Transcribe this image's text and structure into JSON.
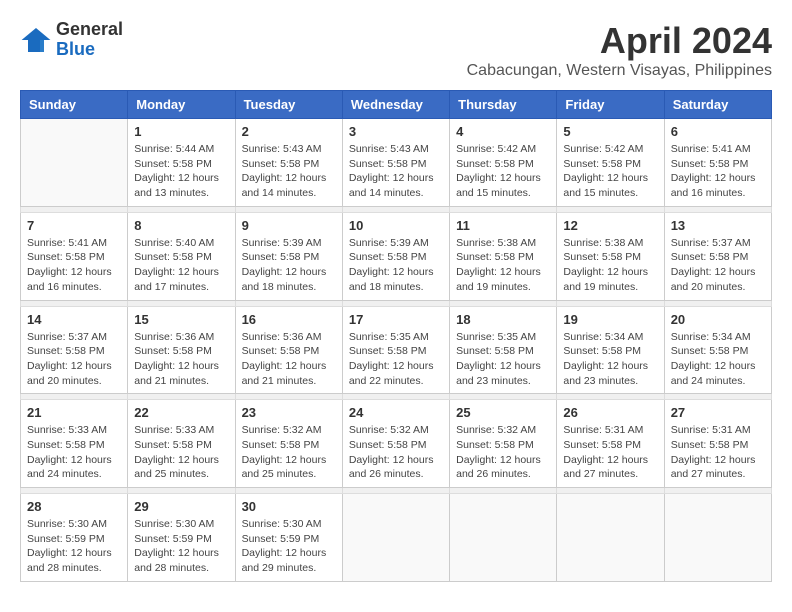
{
  "logo": {
    "general": "General",
    "blue": "Blue"
  },
  "title": "April 2024",
  "location": "Cabacungan, Western Visayas, Philippines",
  "days_of_week": [
    "Sunday",
    "Monday",
    "Tuesday",
    "Wednesday",
    "Thursday",
    "Friday",
    "Saturday"
  ],
  "weeks": [
    [
      {
        "day": "",
        "sunrise": "",
        "sunset": "",
        "daylight": ""
      },
      {
        "day": "1",
        "sunrise": "Sunrise: 5:44 AM",
        "sunset": "Sunset: 5:58 PM",
        "daylight": "Daylight: 12 hours and 13 minutes."
      },
      {
        "day": "2",
        "sunrise": "Sunrise: 5:43 AM",
        "sunset": "Sunset: 5:58 PM",
        "daylight": "Daylight: 12 hours and 14 minutes."
      },
      {
        "day": "3",
        "sunrise": "Sunrise: 5:43 AM",
        "sunset": "Sunset: 5:58 PM",
        "daylight": "Daylight: 12 hours and 14 minutes."
      },
      {
        "day": "4",
        "sunrise": "Sunrise: 5:42 AM",
        "sunset": "Sunset: 5:58 PM",
        "daylight": "Daylight: 12 hours and 15 minutes."
      },
      {
        "day": "5",
        "sunrise": "Sunrise: 5:42 AM",
        "sunset": "Sunset: 5:58 PM",
        "daylight": "Daylight: 12 hours and 15 minutes."
      },
      {
        "day": "6",
        "sunrise": "Sunrise: 5:41 AM",
        "sunset": "Sunset: 5:58 PM",
        "daylight": "Daylight: 12 hours and 16 minutes."
      }
    ],
    [
      {
        "day": "7",
        "sunrise": "Sunrise: 5:41 AM",
        "sunset": "Sunset: 5:58 PM",
        "daylight": "Daylight: 12 hours and 16 minutes."
      },
      {
        "day": "8",
        "sunrise": "Sunrise: 5:40 AM",
        "sunset": "Sunset: 5:58 PM",
        "daylight": "Daylight: 12 hours and 17 minutes."
      },
      {
        "day": "9",
        "sunrise": "Sunrise: 5:39 AM",
        "sunset": "Sunset: 5:58 PM",
        "daylight": "Daylight: 12 hours and 18 minutes."
      },
      {
        "day": "10",
        "sunrise": "Sunrise: 5:39 AM",
        "sunset": "Sunset: 5:58 PM",
        "daylight": "Daylight: 12 hours and 18 minutes."
      },
      {
        "day": "11",
        "sunrise": "Sunrise: 5:38 AM",
        "sunset": "Sunset: 5:58 PM",
        "daylight": "Daylight: 12 hours and 19 minutes."
      },
      {
        "day": "12",
        "sunrise": "Sunrise: 5:38 AM",
        "sunset": "Sunset: 5:58 PM",
        "daylight": "Daylight: 12 hours and 19 minutes."
      },
      {
        "day": "13",
        "sunrise": "Sunrise: 5:37 AM",
        "sunset": "Sunset: 5:58 PM",
        "daylight": "Daylight: 12 hours and 20 minutes."
      }
    ],
    [
      {
        "day": "14",
        "sunrise": "Sunrise: 5:37 AM",
        "sunset": "Sunset: 5:58 PM",
        "daylight": "Daylight: 12 hours and 20 minutes."
      },
      {
        "day": "15",
        "sunrise": "Sunrise: 5:36 AM",
        "sunset": "Sunset: 5:58 PM",
        "daylight": "Daylight: 12 hours and 21 minutes."
      },
      {
        "day": "16",
        "sunrise": "Sunrise: 5:36 AM",
        "sunset": "Sunset: 5:58 PM",
        "daylight": "Daylight: 12 hours and 21 minutes."
      },
      {
        "day": "17",
        "sunrise": "Sunrise: 5:35 AM",
        "sunset": "Sunset: 5:58 PM",
        "daylight": "Daylight: 12 hours and 22 minutes."
      },
      {
        "day": "18",
        "sunrise": "Sunrise: 5:35 AM",
        "sunset": "Sunset: 5:58 PM",
        "daylight": "Daylight: 12 hours and 23 minutes."
      },
      {
        "day": "19",
        "sunrise": "Sunrise: 5:34 AM",
        "sunset": "Sunset: 5:58 PM",
        "daylight": "Daylight: 12 hours and 23 minutes."
      },
      {
        "day": "20",
        "sunrise": "Sunrise: 5:34 AM",
        "sunset": "Sunset: 5:58 PM",
        "daylight": "Daylight: 12 hours and 24 minutes."
      }
    ],
    [
      {
        "day": "21",
        "sunrise": "Sunrise: 5:33 AM",
        "sunset": "Sunset: 5:58 PM",
        "daylight": "Daylight: 12 hours and 24 minutes."
      },
      {
        "day": "22",
        "sunrise": "Sunrise: 5:33 AM",
        "sunset": "Sunset: 5:58 PM",
        "daylight": "Daylight: 12 hours and 25 minutes."
      },
      {
        "day": "23",
        "sunrise": "Sunrise: 5:32 AM",
        "sunset": "Sunset: 5:58 PM",
        "daylight": "Daylight: 12 hours and 25 minutes."
      },
      {
        "day": "24",
        "sunrise": "Sunrise: 5:32 AM",
        "sunset": "Sunset: 5:58 PM",
        "daylight": "Daylight: 12 hours and 26 minutes."
      },
      {
        "day": "25",
        "sunrise": "Sunrise: 5:32 AM",
        "sunset": "Sunset: 5:58 PM",
        "daylight": "Daylight: 12 hours and 26 minutes."
      },
      {
        "day": "26",
        "sunrise": "Sunrise: 5:31 AM",
        "sunset": "Sunset: 5:58 PM",
        "daylight": "Daylight: 12 hours and 27 minutes."
      },
      {
        "day": "27",
        "sunrise": "Sunrise: 5:31 AM",
        "sunset": "Sunset: 5:58 PM",
        "daylight": "Daylight: 12 hours and 27 minutes."
      }
    ],
    [
      {
        "day": "28",
        "sunrise": "Sunrise: 5:30 AM",
        "sunset": "Sunset: 5:59 PM",
        "daylight": "Daylight: 12 hours and 28 minutes."
      },
      {
        "day": "29",
        "sunrise": "Sunrise: 5:30 AM",
        "sunset": "Sunset: 5:59 PM",
        "daylight": "Daylight: 12 hours and 28 minutes."
      },
      {
        "day": "30",
        "sunrise": "Sunrise: 5:30 AM",
        "sunset": "Sunset: 5:59 PM",
        "daylight": "Daylight: 12 hours and 29 minutes."
      },
      {
        "day": "",
        "sunrise": "",
        "sunset": "",
        "daylight": ""
      },
      {
        "day": "",
        "sunrise": "",
        "sunset": "",
        "daylight": ""
      },
      {
        "day": "",
        "sunrise": "",
        "sunset": "",
        "daylight": ""
      },
      {
        "day": "",
        "sunrise": "",
        "sunset": "",
        "daylight": ""
      }
    ]
  ]
}
